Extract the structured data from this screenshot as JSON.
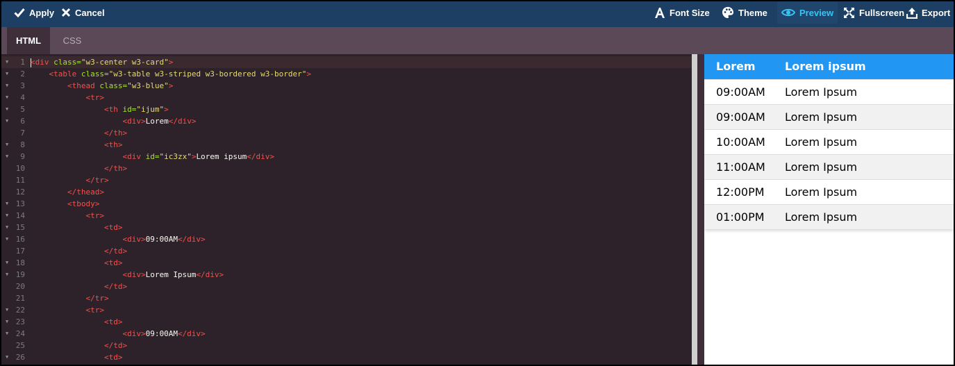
{
  "toolbar": {
    "apply": "Apply",
    "cancel": "Cancel",
    "font_size": "Font Size",
    "theme": "Theme",
    "preview": "Preview",
    "fullscreen": "Fullscreen",
    "export": "Export"
  },
  "tabs": [
    "HTML",
    "CSS"
  ],
  "editor": {
    "lines": [
      [
        [
          "tg",
          "<div "
        ],
        [
          "at",
          "class="
        ],
        [
          "st",
          "\"w3-center w3-card\""
        ],
        [
          "tg",
          ">"
        ]
      ],
      [
        [
          "tx",
          "    "
        ],
        [
          "tg",
          "<table "
        ],
        [
          "at",
          "class="
        ],
        [
          "st",
          "\"w3-table w3-striped w3-bordered w3-border\""
        ],
        [
          "tg",
          ">"
        ]
      ],
      [
        [
          "tx",
          "        "
        ],
        [
          "tg",
          "<thead "
        ],
        [
          "at",
          "class="
        ],
        [
          "st",
          "\"w3-blue\""
        ],
        [
          "tg",
          ">"
        ]
      ],
      [
        [
          "tx",
          "            "
        ],
        [
          "tg",
          "<tr>"
        ]
      ],
      [
        [
          "tx",
          "                "
        ],
        [
          "tg",
          "<th "
        ],
        [
          "at",
          "id="
        ],
        [
          "st",
          "\"ijum\""
        ],
        [
          "tg",
          ">"
        ]
      ],
      [
        [
          "tx",
          "                    "
        ],
        [
          "tg",
          "<div>"
        ],
        [
          "tx",
          "Lorem"
        ],
        [
          "tg",
          "</div>"
        ]
      ],
      [
        [
          "tx",
          "                "
        ],
        [
          "tg",
          "</th>"
        ]
      ],
      [
        [
          "tx",
          "                "
        ],
        [
          "tg",
          "<th>"
        ]
      ],
      [
        [
          "tx",
          "                    "
        ],
        [
          "tg",
          "<div "
        ],
        [
          "at",
          "id="
        ],
        [
          "st",
          "\"ic3zx\""
        ],
        [
          "tg",
          ">"
        ],
        [
          "tx",
          "Lorem ipsum"
        ],
        [
          "tg",
          "</div>"
        ]
      ],
      [
        [
          "tx",
          "                "
        ],
        [
          "tg",
          "</th>"
        ]
      ],
      [
        [
          "tx",
          "            "
        ],
        [
          "tg",
          "</tr>"
        ]
      ],
      [
        [
          "tx",
          "        "
        ],
        [
          "tg",
          "</thead>"
        ]
      ],
      [
        [
          "tx",
          "        "
        ],
        [
          "tg",
          "<tbody>"
        ]
      ],
      [
        [
          "tx",
          "            "
        ],
        [
          "tg",
          "<tr>"
        ]
      ],
      [
        [
          "tx",
          "                "
        ],
        [
          "tg",
          "<td>"
        ]
      ],
      [
        [
          "tx",
          "                    "
        ],
        [
          "tg",
          "<div>"
        ],
        [
          "tx",
          "09:00AM"
        ],
        [
          "tg",
          "</div>"
        ]
      ],
      [
        [
          "tx",
          "                "
        ],
        [
          "tg",
          "</td>"
        ]
      ],
      [
        [
          "tx",
          "                "
        ],
        [
          "tg",
          "<td>"
        ]
      ],
      [
        [
          "tx",
          "                    "
        ],
        [
          "tg",
          "<div>"
        ],
        [
          "tx",
          "Lorem Ipsum"
        ],
        [
          "tg",
          "</div>"
        ]
      ],
      [
        [
          "tx",
          "                "
        ],
        [
          "tg",
          "</td>"
        ]
      ],
      [
        [
          "tx",
          "            "
        ],
        [
          "tg",
          "</tr>"
        ]
      ],
      [
        [
          "tx",
          "            "
        ],
        [
          "tg",
          "<tr>"
        ]
      ],
      [
        [
          "tx",
          "                "
        ],
        [
          "tg",
          "<td>"
        ]
      ],
      [
        [
          "tx",
          "                    "
        ],
        [
          "tg",
          "<div>"
        ],
        [
          "tx",
          "09:00AM"
        ],
        [
          "tg",
          "</div>"
        ]
      ],
      [
        [
          "tx",
          "                "
        ],
        [
          "tg",
          "</td>"
        ]
      ],
      [
        [
          "tx",
          "                "
        ],
        [
          "tg",
          "<td>"
        ]
      ]
    ],
    "foldable": [
      1,
      2,
      3,
      4,
      5,
      6,
      8,
      9,
      13,
      14,
      15,
      16,
      18,
      19,
      22,
      23,
      24,
      26
    ]
  },
  "preview": {
    "headers": [
      "Lorem",
      "Lorem ipsum"
    ],
    "rows": [
      [
        "09:00AM",
        "Lorem Ipsum"
      ],
      [
        "09:00AM",
        "Lorem Ipsum"
      ],
      [
        "10:00AM",
        "Lorem Ipsum"
      ],
      [
        "11:00AM",
        "Lorem Ipsum"
      ],
      [
        "12:00PM",
        "Lorem Ipsum"
      ],
      [
        "01:00PM",
        "Lorem Ipsum"
      ]
    ]
  },
  "colors": {
    "toolbar": "#1e3f64",
    "tabbar": "#5b4957",
    "editor_bg": "#2d2229",
    "accent": "#39c3f2",
    "table_header": "#2196f3"
  }
}
